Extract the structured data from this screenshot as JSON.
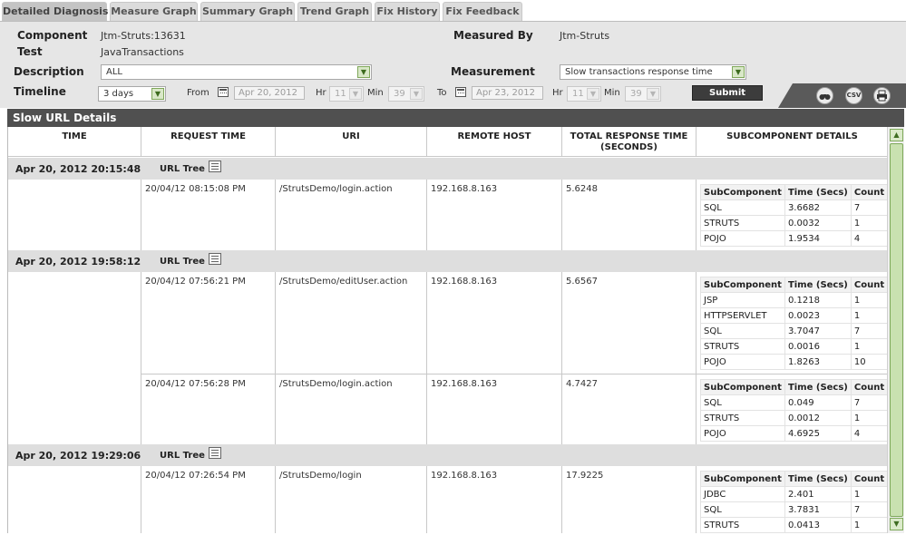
{
  "tabs": [
    "Detailed Diagnosis",
    "Measure Graph",
    "Summary Graph",
    "Trend Graph",
    "Fix History",
    "Fix Feedback"
  ],
  "filter": {
    "component_label": "Component",
    "component_value": "Jtm-Struts:13631",
    "test_label": "Test",
    "test_value": "JavaTransactions",
    "measured_by_label": "Measured By",
    "measured_by_value": "Jtm-Struts",
    "description_label": "Description",
    "description_value": "ALL",
    "measurement_label": "Measurement",
    "measurement_value": "Slow transactions response time",
    "timeline_label": "Timeline",
    "timeline_value": "3 days",
    "from_label": "From",
    "from_date": "Apr 20, 2012",
    "from_hr_label": "Hr",
    "from_hr": "11",
    "from_min_label": "Min",
    "from_min": "39",
    "to_label": "To",
    "to_date": "Apr 23, 2012",
    "to_hr_label": "Hr",
    "to_hr": "11",
    "to_min_label": "Min",
    "to_min": "39",
    "submit_label": "Submit",
    "tools": [
      "binoculars-icon",
      "csv-icon",
      "print-icon"
    ],
    "csv_text": "CSV"
  },
  "section_title": "Slow URL Details",
  "columns": [
    "TIME",
    "REQUEST TIME",
    "URI",
    "REMOTE HOST",
    "TOTAL RESPONSE TIME (SECONDS)",
    "SUBCOMPONENT DETAILS"
  ],
  "subtable_headers": [
    "SubComponent",
    "Time (Secs)",
    "Count"
  ],
  "url_tree_label": "URL Tree",
  "groups": [
    {
      "time": "Apr 20, 2012 20:15:48",
      "rows": [
        {
          "request_time": "20/04/12 08:15:08 PM",
          "uri": "/StrutsDemo/login.action",
          "remote_host": "192.168.8.163",
          "total": "5.6248",
          "subs": [
            [
              "SQL",
              "3.6682",
              "7"
            ],
            [
              "STRUTS",
              "0.0032",
              "1"
            ],
            [
              "POJO",
              "1.9534",
              "4"
            ]
          ]
        }
      ]
    },
    {
      "time": "Apr 20, 2012 19:58:12",
      "rows": [
        {
          "request_time": "20/04/12 07:56:21 PM",
          "uri": "/StrutsDemo/editUser.action",
          "remote_host": "192.168.8.163",
          "total": "5.6567",
          "subs": [
            [
              "JSP",
              "0.1218",
              "1"
            ],
            [
              "HTTPSERVLET",
              "0.0023",
              "1"
            ],
            [
              "SQL",
              "3.7047",
              "7"
            ],
            [
              "STRUTS",
              "0.0016",
              "1"
            ],
            [
              "POJO",
              "1.8263",
              "10"
            ]
          ]
        },
        {
          "request_time": "20/04/12 07:56:28 PM",
          "uri": "/StrutsDemo/login.action",
          "remote_host": "192.168.8.163",
          "total": "4.7427",
          "subs": [
            [
              "SQL",
              "0.049",
              "7"
            ],
            [
              "STRUTS",
              "0.0012",
              "1"
            ],
            [
              "POJO",
              "4.6925",
              "4"
            ]
          ]
        }
      ]
    },
    {
      "time": "Apr 20, 2012 19:29:06",
      "rows": [
        {
          "request_time": "20/04/12 07:26:54 PM",
          "uri": "/StrutsDemo/login",
          "remote_host": "192.168.8.163",
          "total": "17.9225",
          "subs": [
            [
              "JDBC",
              "2.401",
              "1"
            ],
            [
              "SQL",
              "3.7831",
              "7"
            ],
            [
              "STRUTS",
              "0.0413",
              "1"
            ]
          ]
        }
      ]
    }
  ]
}
